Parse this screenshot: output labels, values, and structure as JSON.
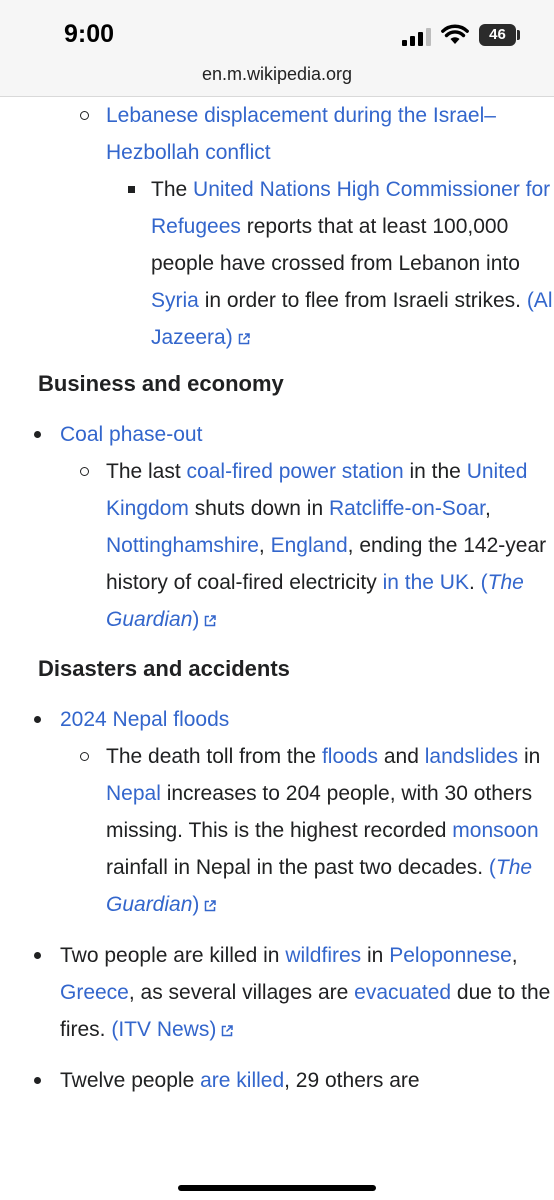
{
  "status": {
    "time": "9:00",
    "battery": "46"
  },
  "browser": {
    "url": "en.m.wikipedia.org"
  },
  "item_lebanon": {
    "link": "Lebanese displacement during the Israel–Hezbollah conflict",
    "sub": {
      "t1": "The ",
      "l1": "United Nations High Commissioner for Refugees",
      "t2": " reports that at least 100,000 people have crossed from Lebanon into ",
      "l2": "Syria",
      "t3": " in order to flee from Israeli strikes. ",
      "src": "(Al Jazeera)"
    }
  },
  "section_business": {
    "heading": "Business and economy",
    "topic": "Coal phase-out",
    "sub": {
      "t1": "The last ",
      "l1": "coal-fired power station",
      "t2": " in the ",
      "l2": "United Kingdom",
      "t3": " shuts down in ",
      "l3": "Ratcliffe-on-Soar",
      "t4": ", ",
      "l4": "Nottinghamshire",
      "t5": ", ",
      "l5": "England",
      "t6": ", ending the 142-year history of coal-fired electricity ",
      "l6": "in the UK",
      "t7": ". ",
      "src_open": "(",
      "src_name": "The Guardian",
      "src_close": ")"
    }
  },
  "section_disasters": {
    "heading": "Disasters and accidents",
    "topic": "2024 Nepal floods",
    "sub": {
      "t1": "The death toll from the ",
      "l1": "floods",
      "t2": " and ",
      "l2": "landslides",
      "t3": " in ",
      "l3": "Nepal",
      "t4": " increases to 204 people, with 30 others missing. This is the highest recorded ",
      "l4": "monsoon",
      "t5": " rainfall in Nepal in the past two decades. ",
      "src_open": "(",
      "src_name": "The Guardian",
      "src_close": ")"
    },
    "item2": {
      "t1": "Two people are killed in ",
      "l1": "wildfires",
      "t2": " in ",
      "l2": "Peloponnese",
      "t3": ", ",
      "l3": "Greece",
      "t4": ", as several villages are ",
      "l4": "evacuated",
      "t5": " due to the fires. ",
      "src": "(ITV News)"
    },
    "item3": {
      "t1": "Twelve people ",
      "l1": "are killed",
      "t2": ", 29 others are"
    }
  }
}
